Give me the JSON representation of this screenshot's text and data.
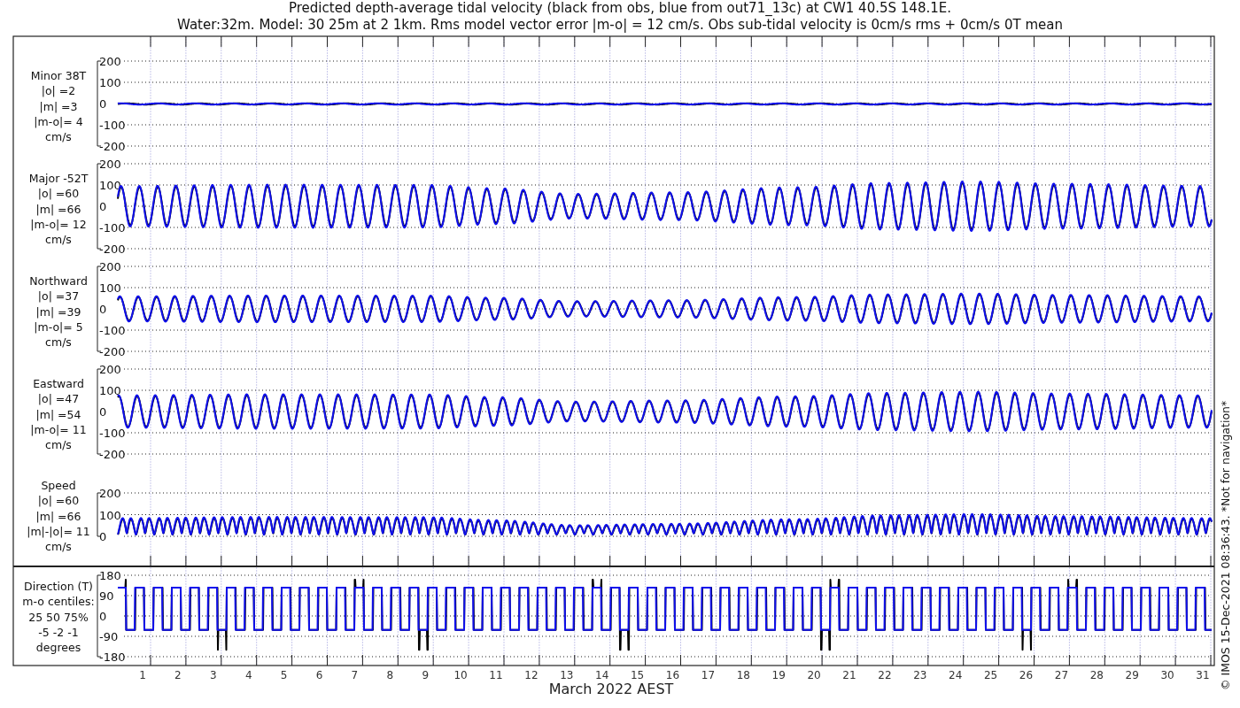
{
  "title": "Predicted depth-average tidal velocity (black from obs, blue from out71_13c) at CW1 40.5S 148.1E.",
  "subtitle": "Water:32m. Model: 30 25m at 2 1km. Rms model vector error |m-o| = 12 cm/s. Obs sub-tidal velocity is 0cm/s rms + 0cm/s 0T mean",
  "panels": [
    {
      "kind": "velocity",
      "label": [
        "Minor 38T",
        "|o| =2",
        "|m| =3",
        "|m-o|= 4",
        "cm/s"
      ],
      "yticks": [
        "200",
        "100",
        "0",
        "-100",
        "-200"
      ]
    },
    {
      "kind": "velocity",
      "label": [
        "Major -52T",
        "|o| =60",
        "|m| =66",
        "|m-o|= 12",
        "cm/s"
      ],
      "yticks": [
        "200",
        "100",
        "0",
        "-100",
        "-200"
      ]
    },
    {
      "kind": "velocity",
      "label": [
        "Northward",
        "|o| =37",
        "|m| =39",
        "|m-o|= 5",
        "cm/s"
      ],
      "yticks": [
        "200",
        "100",
        "0",
        "-100",
        "-200"
      ]
    },
    {
      "kind": "velocity",
      "label": [
        "Eastward",
        "|o| =47",
        "|m| =54",
        "|m-o|= 11",
        "cm/s"
      ],
      "yticks": [
        "200",
        "100",
        "0",
        "-100",
        "-200"
      ]
    },
    {
      "kind": "speed",
      "label": [
        "Speed",
        "|o| =60",
        "|m| =66",
        "|m|-|o|= 11",
        "cm/s"
      ],
      "yticks": [
        "200",
        "100",
        "0"
      ]
    },
    {
      "kind": "direction",
      "label": [
        "Direction (T)",
        "m-o centiles:",
        "25  50  75%",
        "-5 -2 -1",
        "degrees"
      ],
      "yticks": [
        "180",
        "90",
        "0",
        "-90",
        "-180"
      ]
    }
  ],
  "xticks": [
    "1",
    "2",
    "3",
    "4",
    "5",
    "6",
    "7",
    "8",
    "9",
    "10",
    "11",
    "12",
    "13",
    "14",
    "15",
    "16",
    "17",
    "18",
    "19",
    "20",
    "21",
    "22",
    "23",
    "24",
    "25",
    "26",
    "27",
    "28",
    "29",
    "30",
    "31"
  ],
  "xlabel": "March 2022 AEST",
  "credit": "© IMOS 15-Dec-2021 08:36:43. *Not for navigation*"
}
